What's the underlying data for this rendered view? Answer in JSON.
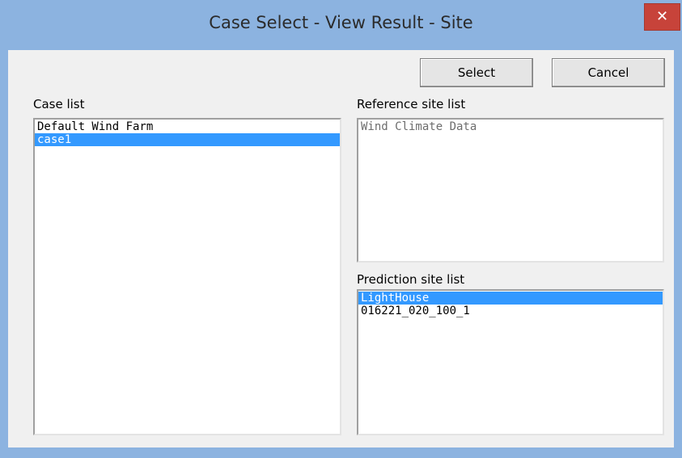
{
  "window": {
    "title": "Case Select - View Result - Site",
    "close_glyph": "✕"
  },
  "buttons": {
    "select_label": "Select",
    "cancel_label": "Cancel"
  },
  "case_list": {
    "label": "Case list",
    "items": [
      "Default Wind Farm",
      "case1"
    ],
    "selected_index": 1
  },
  "reference_site_list": {
    "label": "Reference site list",
    "items": [
      "Wind Climate Data"
    ]
  },
  "prediction_site_list": {
    "label": "Prediction site list",
    "items": [
      "LightHouse",
      "016221_020_100_1"
    ],
    "selected_index": 0
  },
  "colors": {
    "titlebar": "#8cb3e0",
    "close_button": "#c7433a",
    "selection": "#3399ff",
    "dialog_background": "#f0f0f0"
  }
}
